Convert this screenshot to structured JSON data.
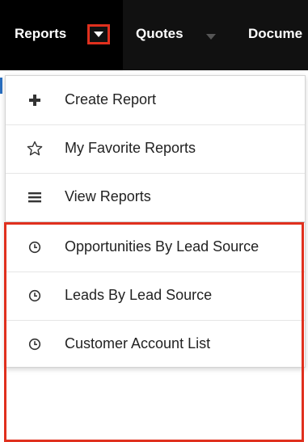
{
  "nav": {
    "reports_label": "Reports",
    "quotes_label": "Quotes",
    "documents_label": "Docume"
  },
  "menu": {
    "items": [
      {
        "label": "Create Report",
        "icon": "plus-icon"
      },
      {
        "label": "My Favorite Reports",
        "icon": "star-outline-icon"
      },
      {
        "label": "View Reports",
        "icon": "list-icon"
      },
      {
        "label": "Opportunities By Lead Source",
        "icon": "clock-icon"
      },
      {
        "label": "Leads By Lead Source",
        "icon": "clock-icon"
      },
      {
        "label": "Customer Account List",
        "icon": "clock-icon"
      }
    ]
  },
  "colors": {
    "nav_bg": "#111111",
    "active_tab_bg": "#000000",
    "highlight": "#e0301e",
    "text": "#222222"
  }
}
